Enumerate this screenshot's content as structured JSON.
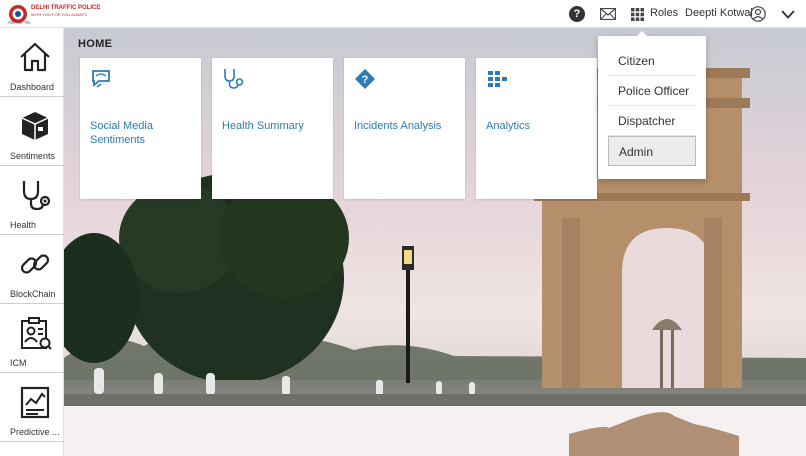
{
  "header": {
    "logo": {
      "brand": "DELHI TRAFFIC POLICE",
      "tagline": "WITH YOU FOR YOU ALWAYS",
      "sub": "शांति सेवा न्याय"
    },
    "help_glyph": "?",
    "roles_label": "Roles",
    "user_name": "Deepti Kotwal"
  },
  "sidebar": {
    "items": [
      {
        "label": "Dashboard",
        "icon": "home-icon"
      },
      {
        "label": "Sentiments",
        "icon": "cube-icon"
      },
      {
        "label": "Health",
        "icon": "stethoscope-icon"
      },
      {
        "label": "BlockChain",
        "icon": "chain-link-icon"
      },
      {
        "label": "ICM",
        "icon": "id-clipboard-icon"
      },
      {
        "label": "Predictive ...",
        "icon": "chart-document-icon"
      }
    ]
  },
  "main": {
    "page_title": "HOME",
    "cards": [
      {
        "label": "Social Media Sentiments",
        "icon": "chat-bubbles-icon"
      },
      {
        "label": "Health Summary",
        "icon": "stethoscope-icon"
      },
      {
        "label": "Incidents Analysis",
        "icon": "question-diamond-icon"
      },
      {
        "label": "Analytics",
        "icon": "blocks-icon"
      }
    ]
  },
  "roles_dropdown": {
    "items": [
      "Citizen",
      "Police Officer",
      "Dispatcher",
      "Admin"
    ],
    "selected": "Admin"
  },
  "colors": {
    "card_text": "#2b7bb9",
    "logo_red": "#c62828"
  }
}
